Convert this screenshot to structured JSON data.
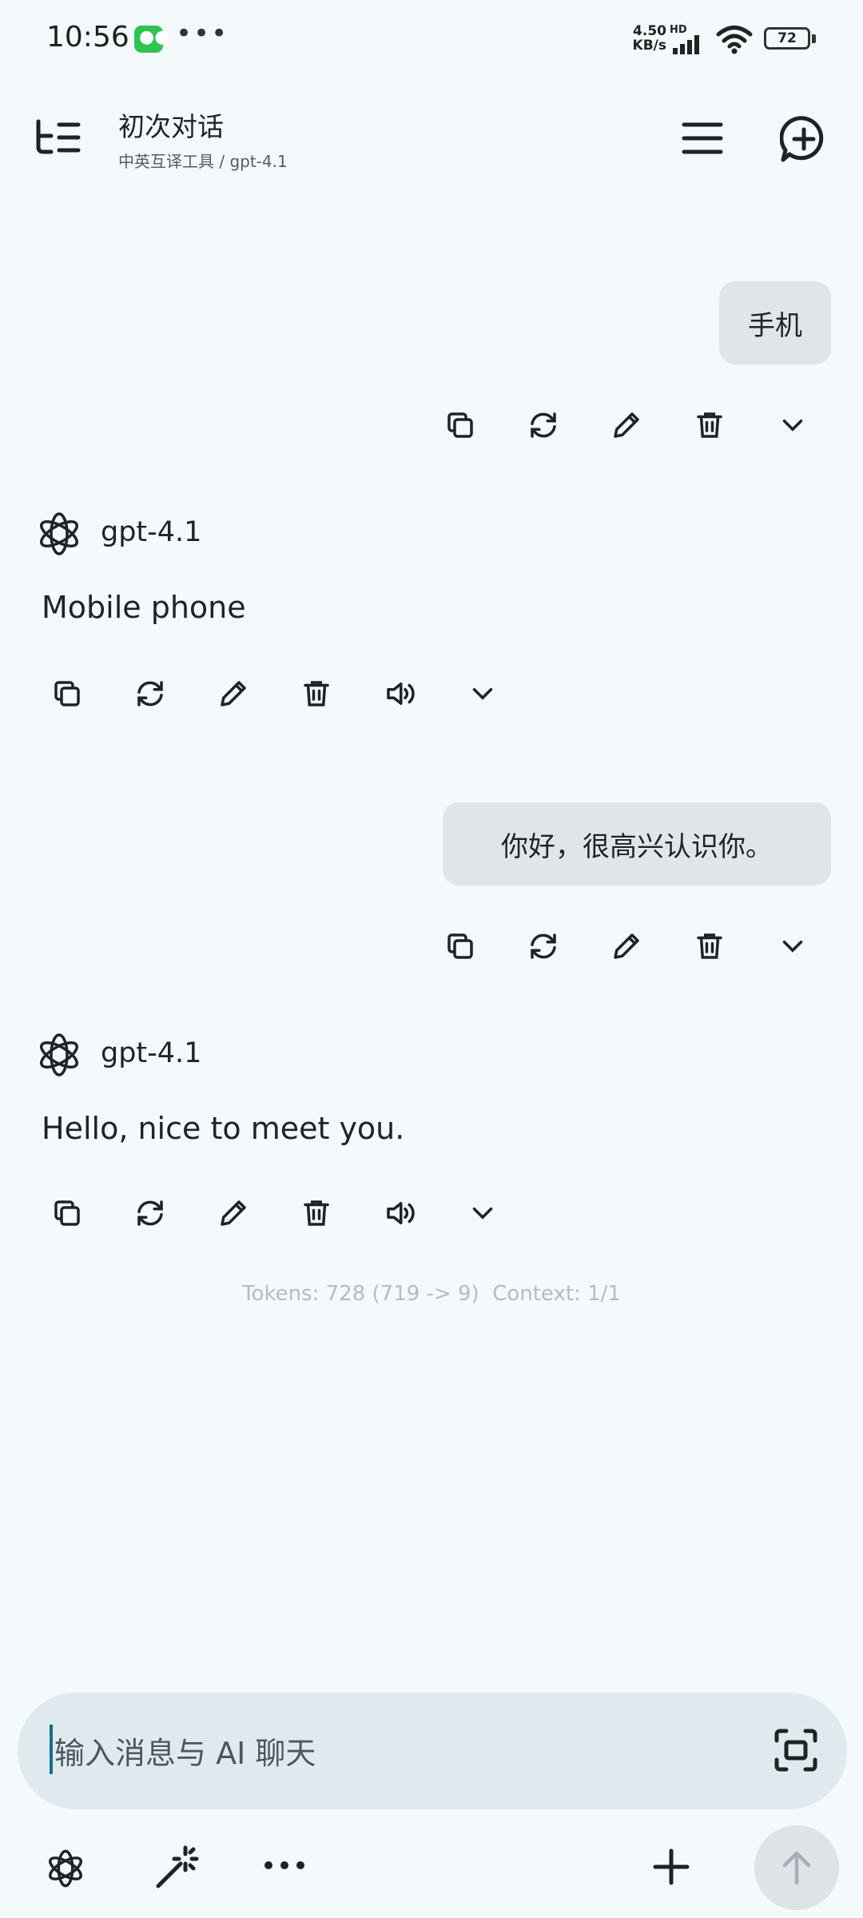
{
  "status_bar": {
    "time": "10:56",
    "more": "•••",
    "net_speed_value": "4.50",
    "net_speed_unit": "KB/s",
    "hd": "HD",
    "battery": "72"
  },
  "header": {
    "title": "初次对话",
    "subtitle": "中英互译工具 / gpt-4.1"
  },
  "messages": [
    {
      "role": "user",
      "text": "手机"
    },
    {
      "role": "assistant",
      "model": "gpt-4.1",
      "text": "Mobile phone"
    },
    {
      "role": "user",
      "text": "你好，很高兴认识你。"
    },
    {
      "role": "assistant",
      "model": "gpt-4.1",
      "text": "Hello, nice to meet you."
    }
  ],
  "footer": {
    "tokens": "Tokens: 728 (719 -> 9)  Context: 1/1"
  },
  "composer": {
    "placeholder": "输入消息与 AI 聊天"
  },
  "icons": {
    "sidebar": "sidebar-icon",
    "menu": "hamburger-menu-icon",
    "new_chat": "new-chat-icon",
    "copy": "copy-icon",
    "regenerate": "regenerate-icon",
    "edit": "pencil-icon",
    "delete": "trash-icon",
    "speak": "speaker-icon",
    "more": "chevron-down-icon",
    "scan": "scan-icon",
    "model": "openai-logo-icon",
    "magic": "magic-wand-icon",
    "add": "plus-icon",
    "send": "arrow-up-icon"
  },
  "colors": {
    "background": "#f4f9fc",
    "user_bubble": "#e1e5e8",
    "input_bar": "#dfeaee",
    "send_button": "#dde3e7",
    "tokens_text": "#b4bcc4"
  }
}
